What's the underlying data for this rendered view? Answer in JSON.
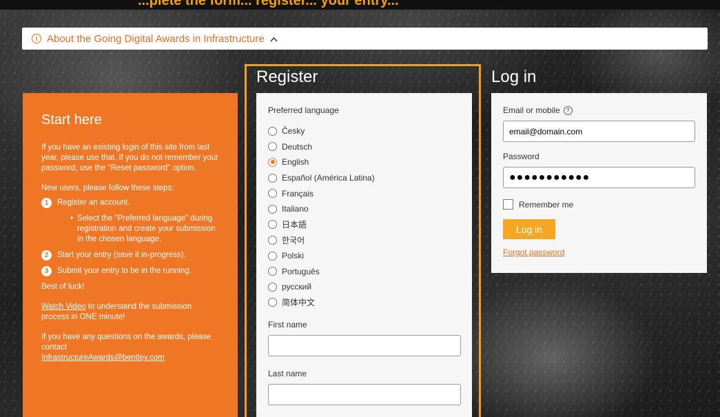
{
  "header": {
    "partial_text": "...plete the form... register... your entry..."
  },
  "about": {
    "label": "About the Going Digital Awards in Infrastructure",
    "info_glyph": "i",
    "chevron_glyph": "^"
  },
  "start": {
    "title": "Start here",
    "intro": "If you have an existing login of this site from last year, please use that. If you do not remember your password, use the \"Reset password\" option.",
    "new_users": "New users, please follow these steps:",
    "steps": [
      {
        "num": "1",
        "text": "Register an account."
      },
      {
        "num": "2",
        "text": "Start your entry (save it in-progress)."
      },
      {
        "num": "3",
        "text": "Submit your entry to be in the running."
      }
    ],
    "sub_step_bullet": "•",
    "sub_step": "Select the \"Preferred language\" during registration and create your submission in the chosen language.",
    "best_luck": "Best of luck!",
    "video_link": "Watch Video",
    "video_rest": " to understand the submission process in ONE minute!",
    "questions": "If you have any questions on the awards, please contact",
    "email_link": "InfrastructureAwards@bentley.com"
  },
  "register": {
    "title": "Register",
    "pref_lang_label": "Preferred language",
    "languages": [
      "Česky",
      "Deutsch",
      "English",
      "Español (América Latina)",
      "Français",
      "Italiano",
      "日本語",
      "한국어",
      "Polski",
      "Português",
      "русский",
      "简体中文"
    ],
    "selected_language": "English",
    "first_name_label": "First name",
    "first_name_value": "",
    "last_name_label": "Last name",
    "last_name_value": ""
  },
  "login": {
    "title": "Log in",
    "email_label": "Email or mobile",
    "help_glyph": "?",
    "email_value": "email@domain.com",
    "password_label": "Password",
    "password_value": "●●●●●●●●●●●",
    "remember_label": "Remember me",
    "remember_checked": false,
    "login_button": "Log in",
    "forgot_link": "Forgot password"
  },
  "colors": {
    "accent_orange": "#ee7624",
    "frame_yellow": "#f4a01c",
    "button_yellow": "#f5a623",
    "card_bg": "#f6f6f6"
  }
}
